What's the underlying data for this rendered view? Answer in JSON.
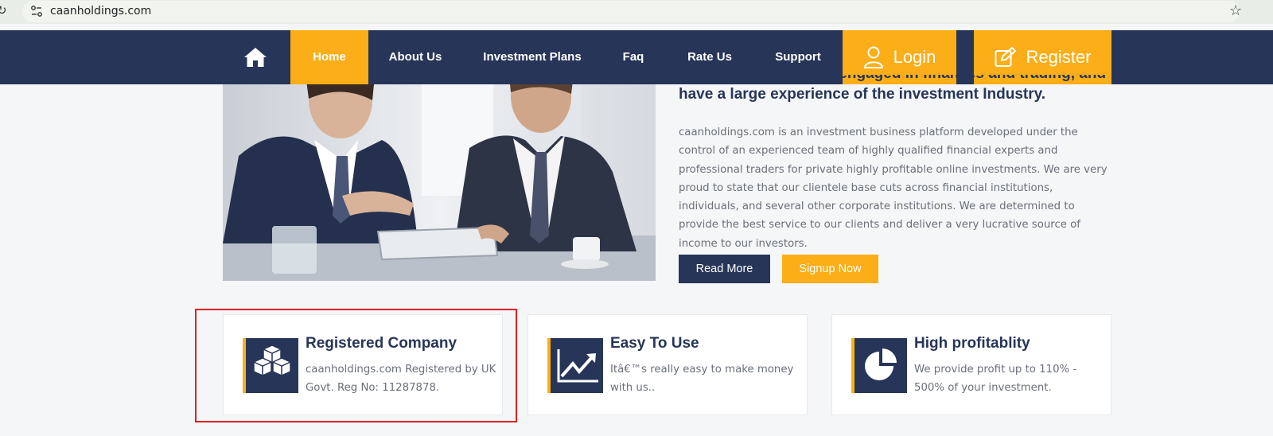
{
  "browser": {
    "url": "caanholdings.com"
  },
  "nav": {
    "items": [
      {
        "label": "Home",
        "active": true
      },
      {
        "label": "About Us"
      },
      {
        "label": "Investment Plans"
      },
      {
        "label": "Faq"
      },
      {
        "label": "Rate Us"
      },
      {
        "label": "Support"
      }
    ],
    "login_label": "Login",
    "register_label": "Register"
  },
  "hero": {
    "heading_line1": "We are professionally engaged in finances and trading, and",
    "heading_line2": "have a large experience of the investment Industry.",
    "body": "caanholdings.com is an investment business platform developed under the control of an experienced team of highly qualified financial experts and professional traders for private highly profitable online investments. We are very proud to state that our clientele base cuts across financial institutions, individuals, and several other corporate institutions. We are determined to provide the best service to our clients and deliver a very lucrative source of income to our investors.",
    "read_more_label": "Read More",
    "signup_label": "Signup Now"
  },
  "features": [
    {
      "title": "Registered Company",
      "text": "caanholdings.com Registered by UK Govt. Reg No: 11287878.",
      "icon": "cubes-icon"
    },
    {
      "title": "Easy To Use",
      "text": "Itâ€™s really easy to make money with us..",
      "icon": "chart-line-icon"
    },
    {
      "title": "High profitablity",
      "text": "We provide profit up to 110% - 500% of your investment.",
      "icon": "pie-chart-icon"
    }
  ],
  "colors": {
    "navy": "#263558",
    "accent": "#fbae17",
    "highlight": "#e02020"
  }
}
